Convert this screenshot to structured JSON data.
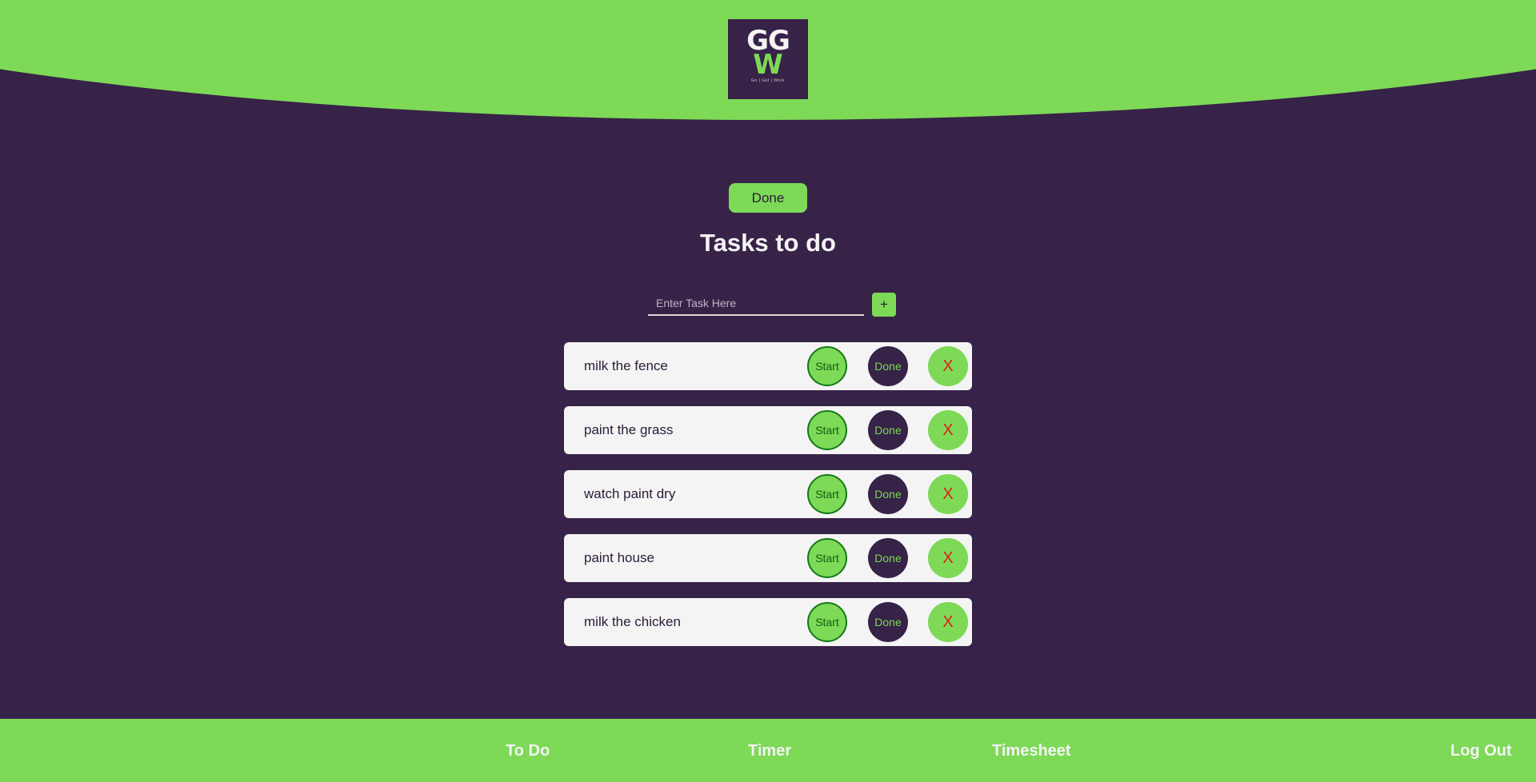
{
  "colors": {
    "background": "#372248",
    "accent": "#7ed957",
    "card": "#f4f4f4",
    "delete": "#e01b1b"
  },
  "logo": {
    "line1": "GG",
    "line2": "W",
    "tagline": "Go  |  Get  |  Work"
  },
  "top_done_label": "Done",
  "title": "Tasks to do",
  "task_input": {
    "placeholder": "Enter Task Here",
    "value": ""
  },
  "add_button_label": "+",
  "tasks": [
    {
      "label": "milk the fence",
      "start": "Start",
      "done": "Done",
      "delete": "X"
    },
    {
      "label": "paint the grass",
      "start": "Start",
      "done": "Done",
      "delete": "X"
    },
    {
      "label": "watch paint dry",
      "start": "Start",
      "done": "Done",
      "delete": "X"
    },
    {
      "label": "paint house",
      "start": "Start",
      "done": "Done",
      "delete": "X"
    },
    {
      "label": "milk the chicken",
      "start": "Start",
      "done": "Done",
      "delete": "X"
    }
  ],
  "nav": {
    "todo": "To Do",
    "timer": "Timer",
    "timesheet": "Timesheet",
    "logout": "Log Out"
  }
}
